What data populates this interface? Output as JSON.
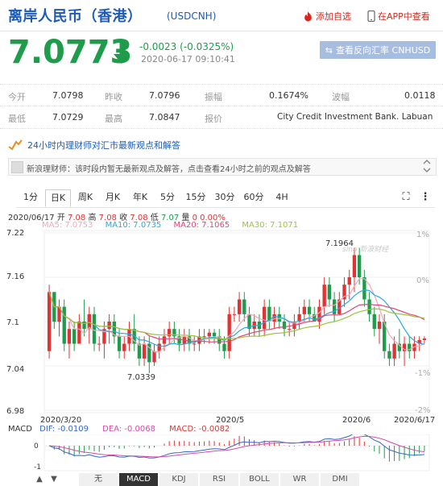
{
  "header": {
    "title": "离岸人民币（香港）",
    "code": "(USDCNH)",
    "add_favorite": "添加自选",
    "open_in_app": "在APP中查看"
  },
  "quote": {
    "price": "7.0773",
    "change": "-0.0023 (-0.0325%)",
    "timestamp": "2020-06-17 09:10:41",
    "reverse_button": "查看反向汇率 CNHUSD"
  },
  "stats": {
    "row1": [
      {
        "label": "今开",
        "value": "7.0798"
      },
      {
        "label": "昨收",
        "value": "7.0796"
      },
      {
        "label": "振幅",
        "value": "0.1674%"
      },
      {
        "label": "波幅",
        "value": "0.0118"
      }
    ],
    "row2": [
      {
        "label": "最低",
        "value": "7.0729"
      },
      {
        "label": "最高",
        "value": "7.0847"
      },
      {
        "label": "报价",
        "value": "City Credit Investment Bank. Labuan"
      }
    ]
  },
  "news": {
    "title": "24小时内理财师对汇市最新观点和解答",
    "message": "新浪理财师：该时段内暂无最新观点及解答，点击查看24小时之前的观点及解答"
  },
  "chart_tabs": [
    "1分",
    "日K",
    "周K",
    "月K",
    "年K",
    "5分",
    "15分",
    "30分",
    "60分",
    "4H"
  ],
  "active_tab": "日K",
  "ohlc_line": {
    "date": "2020/06/17",
    "open_label": "开",
    "open": "7.08",
    "high_label": "高",
    "high": "7.08",
    "low_label": "收",
    "low": "7.08",
    "low2_label": "低",
    "low2": "7.07",
    "vol_label": "量",
    "vol": "0",
    "pct": "0.00%"
  },
  "ma_line": [
    {
      "label": "MA5: 7.0753",
      "color": "#f4a6b7"
    },
    {
      "label": "MA10: 7.0735",
      "color": "#29a9e0"
    },
    {
      "label": "MA20: 7.1065",
      "color": "#e0477a"
    },
    {
      "label": "MA30: 7.1071",
      "color": "#9bc53d"
    }
  ],
  "macd_line": {
    "name": "MACD",
    "dif": "DIF: -0.0109",
    "dea": "DEA: -0.0068",
    "macd": "MACD: -0.0082"
  },
  "watermark": "sina 新浪财经",
  "bottom_tabs": [
    "无",
    "MACD",
    "KDJ",
    "RSI",
    "BOLL",
    "WR",
    "DMI"
  ],
  "active_bottom_tab": "MACD",
  "colors": {
    "up": "#e03333",
    "down": "#1e9c4b",
    "brand": "#1d5bb4"
  },
  "chart_data": {
    "type": "candlestick",
    "y_ticks": [
      "7.22",
      "7.16",
      "7.1",
      "7.04",
      "6.98"
    ],
    "y_pct_ticks": [
      "1%",
      "0%",
      "-1%",
      "-2%"
    ],
    "x_ticks": [
      "2020/3/20",
      "2020/5",
      "2020/6",
      "2020/6/17"
    ],
    "annotations": {
      "high": "7.1964",
      "low": "7.0339"
    },
    "macd_ticks": [
      "0",
      "-1"
    ],
    "ylim": [
      6.98,
      7.22
    ],
    "ohlc": [
      [
        7.06,
        7.15,
        7.05,
        7.14
      ],
      [
        7.14,
        7.14,
        7.09,
        7.1
      ],
      [
        7.1,
        7.13,
        7.08,
        7.12
      ],
      [
        7.12,
        7.13,
        7.06,
        7.07
      ],
      [
        7.07,
        7.1,
        7.05,
        7.09
      ],
      [
        7.09,
        7.1,
        7.06,
        7.07
      ],
      [
        7.07,
        7.11,
        7.07,
        7.1
      ],
      [
        7.1,
        7.13,
        7.08,
        7.09
      ],
      [
        7.09,
        7.12,
        7.07,
        7.11
      ],
      [
        7.11,
        7.12,
        7.06,
        7.07
      ],
      [
        7.07,
        7.08,
        7.06,
        7.07
      ],
      [
        7.07,
        7.1,
        7.05,
        7.09
      ],
      [
        7.09,
        7.11,
        7.07,
        7.1
      ],
      [
        7.1,
        7.11,
        7.07,
        7.08
      ],
      [
        7.08,
        7.09,
        7.05,
        7.06
      ],
      [
        7.06,
        7.08,
        7.05,
        7.07
      ],
      [
        7.07,
        7.1,
        7.06,
        7.09
      ],
      [
        7.09,
        7.11,
        7.06,
        7.07
      ],
      [
        7.07,
        7.08,
        7.04,
        7.05
      ],
      [
        7.05,
        7.08,
        7.04,
        7.07
      ],
      [
        7.07,
        7.08,
        7.03,
        7.045
      ],
      [
        7.045,
        7.07,
        7.04,
        7.06
      ],
      [
        7.06,
        7.08,
        7.05,
        7.07
      ],
      [
        7.07,
        7.09,
        7.06,
        7.08
      ],
      [
        7.08,
        7.1,
        7.07,
        7.09
      ],
      [
        7.09,
        7.1,
        7.07,
        7.08
      ],
      [
        7.08,
        7.09,
        7.06,
        7.07
      ],
      [
        7.07,
        7.09,
        7.06,
        7.08
      ],
      [
        7.08,
        7.09,
        7.06,
        7.07
      ],
      [
        7.07,
        7.08,
        7.06,
        7.07
      ],
      [
        7.07,
        7.09,
        7.06,
        7.08
      ],
      [
        7.08,
        7.09,
        7.07,
        7.08
      ],
      [
        7.08,
        7.09,
        7.07,
        7.085
      ],
      [
        7.085,
        7.09,
        7.07,
        7.08
      ],
      [
        7.08,
        7.09,
        7.06,
        7.07
      ],
      [
        7.07,
        7.08,
        7.05,
        7.06
      ],
      [
        7.06,
        7.12,
        7.05,
        7.11
      ],
      [
        7.11,
        7.12,
        7.1,
        7.11
      ],
      [
        7.11,
        7.14,
        7.1,
        7.13
      ],
      [
        7.13,
        7.14,
        7.1,
        7.11
      ],
      [
        7.11,
        7.12,
        7.08,
        7.09
      ],
      [
        7.09,
        7.11,
        7.08,
        7.1
      ],
      [
        7.1,
        7.11,
        7.08,
        7.09
      ],
      [
        7.09,
        7.13,
        7.08,
        7.12
      ],
      [
        7.12,
        7.13,
        7.09,
        7.1
      ],
      [
        7.1,
        7.12,
        7.09,
        7.11
      ],
      [
        7.11,
        7.12,
        7.09,
        7.1
      ],
      [
        7.1,
        7.11,
        7.08,
        7.09
      ],
      [
        7.09,
        7.1,
        7.08,
        7.09
      ],
      [
        7.09,
        7.11,
        7.08,
        7.1
      ],
      [
        7.1,
        7.12,
        7.09,
        7.11
      ],
      [
        7.11,
        7.13,
        7.1,
        7.12
      ],
      [
        7.12,
        7.13,
        7.1,
        7.11
      ],
      [
        7.11,
        7.12,
        7.1,
        7.1
      ],
      [
        7.1,
        7.13,
        7.09,
        7.12
      ],
      [
        7.12,
        7.16,
        7.11,
        7.15
      ],
      [
        7.15,
        7.16,
        7.12,
        7.13
      ],
      [
        7.13,
        7.14,
        7.1,
        7.11
      ],
      [
        7.11,
        7.14,
        7.11,
        7.13
      ],
      [
        7.13,
        7.16,
        7.12,
        7.15
      ],
      [
        7.15,
        7.17,
        7.13,
        7.16
      ],
      [
        7.16,
        7.2,
        7.14,
        7.19
      ],
      [
        7.19,
        7.2,
        7.15,
        7.16
      ],
      [
        7.16,
        7.17,
        7.12,
        7.13
      ],
      [
        7.13,
        7.14,
        7.1,
        7.11
      ],
      [
        7.11,
        7.12,
        7.08,
        7.09
      ],
      [
        7.09,
        7.11,
        7.07,
        7.1
      ],
      [
        7.1,
        7.11,
        7.05,
        7.06
      ],
      [
        7.06,
        7.07,
        7.04,
        7.05
      ],
      [
        7.05,
        7.08,
        7.04,
        7.07
      ],
      [
        7.07,
        7.09,
        7.05,
        7.06
      ],
      [
        7.06,
        7.08,
        7.04,
        7.07
      ],
      [
        7.07,
        7.08,
        7.05,
        7.06
      ],
      [
        7.06,
        7.08,
        7.05,
        7.07
      ],
      [
        7.07,
        7.08,
        7.06,
        7.075
      ],
      [
        7.075,
        7.08,
        7.07,
        7.077
      ]
    ]
  }
}
